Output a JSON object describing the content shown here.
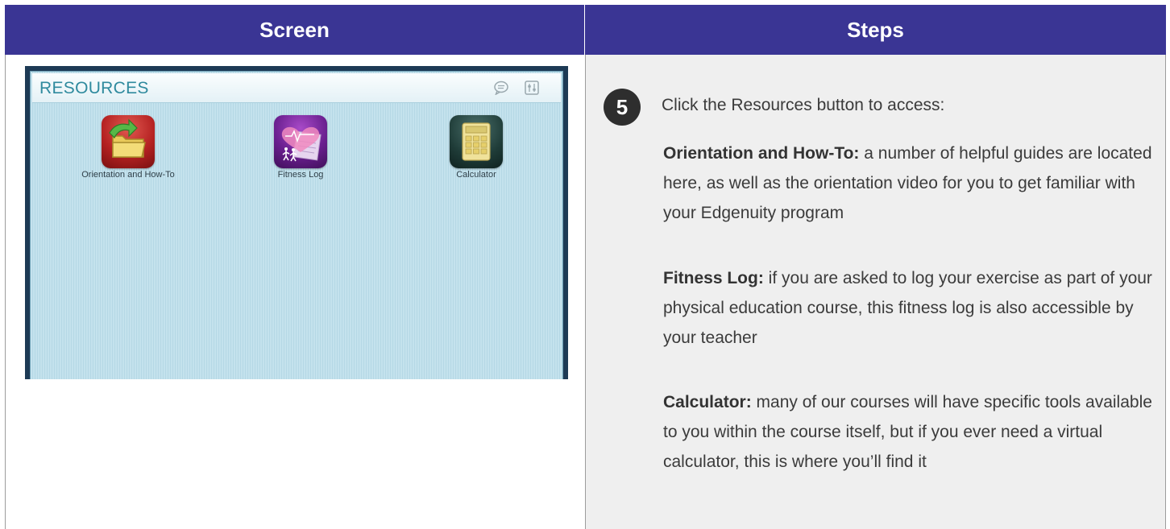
{
  "header": {
    "screen_label": "Screen",
    "steps_label": "Steps"
  },
  "resources_panel": {
    "title": "RESOURCES",
    "icons": [
      "chat-icon",
      "tools-icon"
    ],
    "apps": [
      {
        "label": "Orientation and How-To",
        "icon": "folder-arrow-icon"
      },
      {
        "label": "Fitness Log",
        "icon": "fitness-log-icon"
      },
      {
        "label": "Calculator",
        "icon": "calculator-icon"
      }
    ]
  },
  "step": {
    "number": "5",
    "intro": "Click the Resources button to access:",
    "items": [
      {
        "term": "Orientation and How-To:",
        "text": " a number of helpful guides are located here, as well as the orientation video for you to get familiar with your Edgenuity program"
      },
      {
        "term": "Fitness Log:",
        "text": " if you are asked to log your exercise as part of your physical education course, this fitness log is also accessible by your teacher"
      },
      {
        "term": "Calculator:",
        "text": " many of our courses will have specific tools available to you within the course itself, but if you ever need a virtual calculator, this is where you’ll find it"
      }
    ]
  },
  "colors": {
    "header_bg": "#3a3594",
    "steps_bg": "#efefef",
    "badge_bg": "#2e2e2e",
    "resources_title": "#2f8a9e"
  }
}
